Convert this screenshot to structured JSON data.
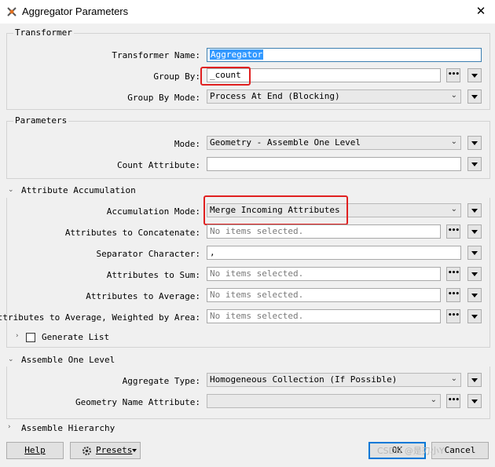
{
  "window": {
    "title": "Aggregator Parameters",
    "close_glyph": "✕"
  },
  "transformer": {
    "legend": "Transformer",
    "name_label": "Transformer Name:",
    "name_value": "Aggregator",
    "group_by_label": "Group By:",
    "group_by_value": "_count",
    "group_by_mode_label": "Group By Mode:",
    "group_by_mode_value": "Process At End (Blocking)"
  },
  "parameters": {
    "legend": "Parameters",
    "mode_label": "Mode:",
    "mode_value": "Geometry - Assemble One Level",
    "count_attribute_label": "Count Attribute:",
    "count_attribute_value": ""
  },
  "attribute_accumulation": {
    "title": "Attribute Accumulation",
    "accumulation_mode_label": "Accumulation Mode:",
    "accumulation_mode_value": "Merge Incoming Attributes",
    "concatenate_label": "Attributes to Concatenate:",
    "concatenate_value": "No items selected.",
    "separator_label": "Separator Character:",
    "separator_value": ",",
    "sum_label": "Attributes to Sum:",
    "sum_value": "No items selected.",
    "average_label": "Attributes to Average:",
    "average_value": "No items selected.",
    "weighted_label": "Attributes to Average, Weighted by Area:",
    "weighted_value": "No items selected.",
    "generate_list_label": "Generate List"
  },
  "assemble_one_level": {
    "title": "Assemble One Level",
    "aggregate_type_label": "Aggregate Type:",
    "aggregate_type_value": "Homogeneous Collection (If Possible)",
    "geometry_name_label": "Geometry Name Attribute:",
    "geometry_name_value": ""
  },
  "assemble_hierarchy": {
    "title": "Assemble Hierarchy"
  },
  "footer": {
    "help_label": "Help",
    "presets_label": "Presets",
    "ok_label": "OK",
    "cancel_label": "Cancel"
  },
  "watermark": "CSDN @是刃小Y",
  "icons": {
    "dots": "•••",
    "chevron_down": "⌄",
    "chevron_right": "›",
    "chevron_down_section": "⌄"
  },
  "colors": {
    "highlight": "#e02020",
    "selection": "#3399ff",
    "focus": "#0078d7"
  }
}
